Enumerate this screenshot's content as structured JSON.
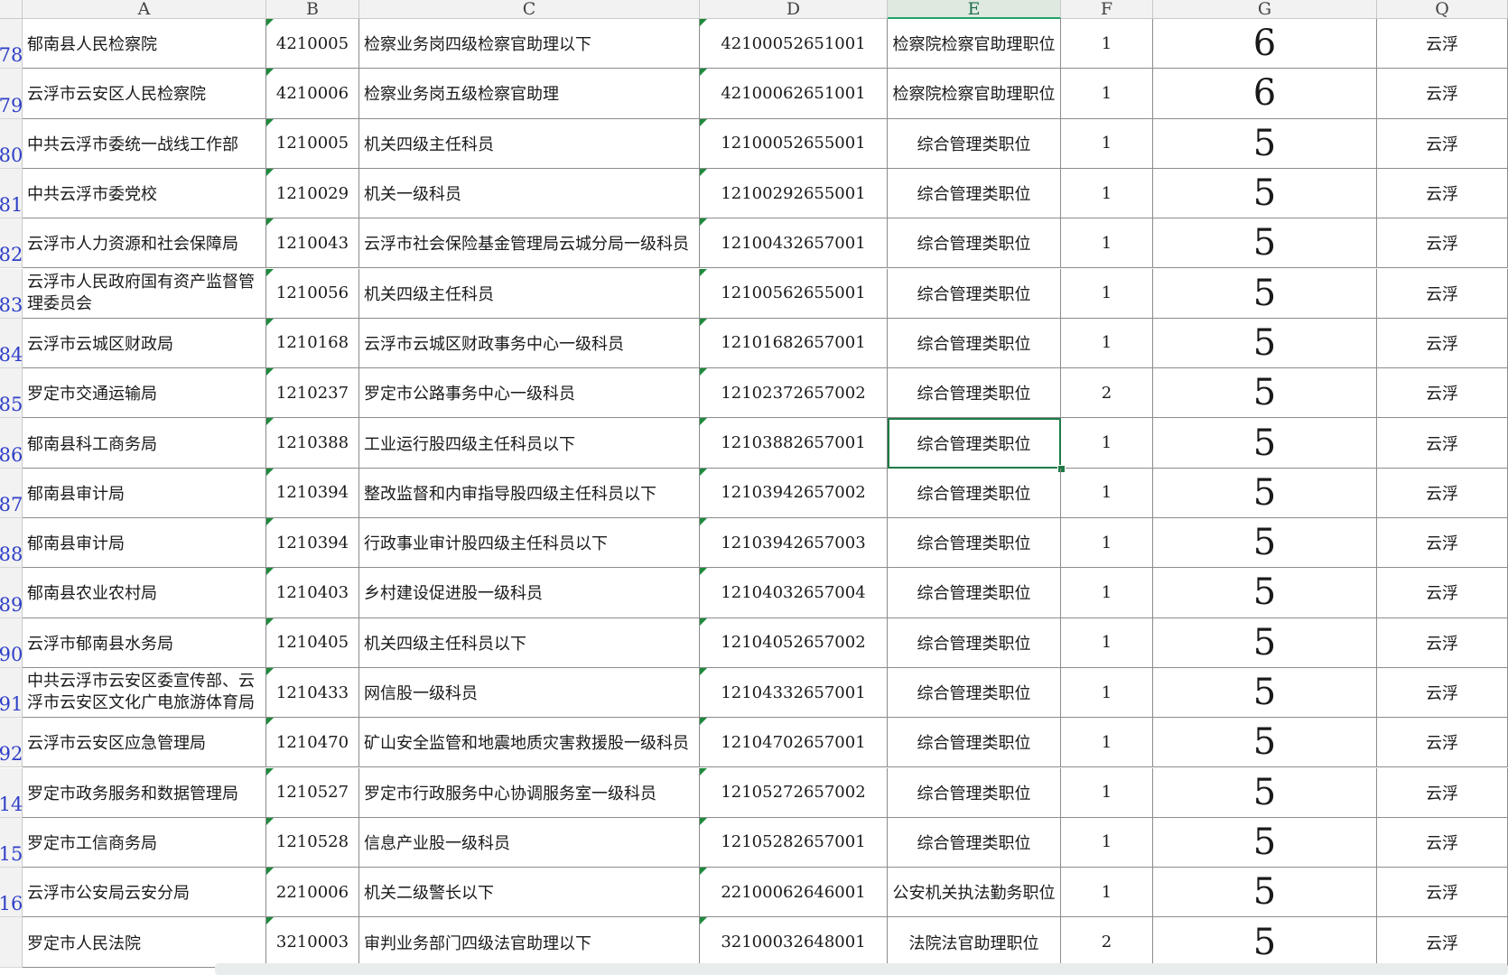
{
  "columns": [
    "A",
    "B",
    "C",
    "D",
    "E",
    "F",
    "G",
    "Q"
  ],
  "selected_column": "E",
  "selected_row": "86",
  "rows": [
    {
      "num": "78",
      "a": "郁南县人民检察院",
      "b": "4210005",
      "c": "检察业务岗四级检察官助理以下",
      "d": "42100052651001",
      "e": "检察院检察官助理职位",
      "f": "1",
      "g": "6",
      "q": "云浮"
    },
    {
      "num": "79",
      "a": "云浮市云安区人民检察院",
      "b": "4210006",
      "c": "检察业务岗五级检察官助理",
      "d": "42100062651001",
      "e": "检察院检察官助理职位",
      "f": "1",
      "g": "6",
      "q": "云浮"
    },
    {
      "num": "80",
      "a": "中共云浮市委统一战线工作部",
      "b": "1210005",
      "c": "机关四级主任科员",
      "d": "12100052655001",
      "e": "综合管理类职位",
      "f": "1",
      "g": "5",
      "q": "云浮"
    },
    {
      "num": "81",
      "a": "中共云浮市委党校",
      "b": "1210029",
      "c": "机关一级科员",
      "d": "12100292655001",
      "e": "综合管理类职位",
      "f": "1",
      "g": "5",
      "q": "云浮"
    },
    {
      "num": "82",
      "a": "云浮市人力资源和社会保障局",
      "b": "1210043",
      "c": "云浮市社会保险基金管理局云城分局一级科员",
      "d": "12100432657001",
      "e": "综合管理类职位",
      "f": "1",
      "g": "5",
      "q": "云浮"
    },
    {
      "num": "83",
      "a": "云浮市人民政府国有资产监督管理委员会",
      "b": "1210056",
      "c": "机关四级主任科员",
      "d": "12100562655001",
      "e": "综合管理类职位",
      "f": "1",
      "g": "5",
      "q": "云浮"
    },
    {
      "num": "84",
      "a": "云浮市云城区财政局",
      "b": "1210168",
      "c": "云浮市云城区财政事务中心一级科员",
      "d": "12101682657001",
      "e": "综合管理类职位",
      "f": "1",
      "g": "5",
      "q": "云浮"
    },
    {
      "num": "85",
      "a": "罗定市交通运输局",
      "b": "1210237",
      "c": "罗定市公路事务中心一级科员",
      "d": "12102372657002",
      "e": "综合管理类职位",
      "f": "2",
      "g": "5",
      "q": "云浮"
    },
    {
      "num": "86",
      "a": "郁南县科工商务局",
      "b": "1210388",
      "c": "工业运行股四级主任科员以下",
      "d": "12103882657001",
      "e": "综合管理类职位",
      "f": "1",
      "g": "5",
      "q": "云浮"
    },
    {
      "num": "87",
      "a": "郁南县审计局",
      "b": "1210394",
      "c": "整改监督和内审指导股四级主任科员以下",
      "d": "12103942657002",
      "e": "综合管理类职位",
      "f": "1",
      "g": "5",
      "q": "云浮"
    },
    {
      "num": "88",
      "a": "郁南县审计局",
      "b": "1210394",
      "c": "行政事业审计股四级主任科员以下",
      "d": "12103942657003",
      "e": "综合管理类职位",
      "f": "1",
      "g": "5",
      "q": "云浮"
    },
    {
      "num": "89",
      "a": "郁南县农业农村局",
      "b": "1210403",
      "c": "乡村建设促进股一级科员",
      "d": "12104032657004",
      "e": "综合管理类职位",
      "f": "1",
      "g": "5",
      "q": "云浮"
    },
    {
      "num": "90",
      "a": "云浮市郁南县水务局",
      "b": "1210405",
      "c": "机关四级主任科员以下",
      "d": "12104052657002",
      "e": "综合管理类职位",
      "f": "1",
      "g": "5",
      "q": "云浮"
    },
    {
      "num": "91",
      "a": "中共云浮市云安区委宣传部、云浮市云安区文化广电旅游体育局",
      "b": "1210433",
      "c": "网信股一级科员",
      "d": "12104332657001",
      "e": "综合管理类职位",
      "f": "1",
      "g": "5",
      "q": "云浮"
    },
    {
      "num": "92",
      "a": "云浮市云安区应急管理局",
      "b": "1210470",
      "c": "矿山安全监管和地震地质灾害救援股一级科员",
      "d": "12104702657001",
      "e": "综合管理类职位",
      "f": "1",
      "g": "5",
      "q": "云浮"
    },
    {
      "num": "14",
      "a": "罗定市政务服务和数据管理局",
      "b": "1210527",
      "c": "罗定市行政服务中心协调服务室一级科员",
      "d": "12105272657002",
      "e": "综合管理类职位",
      "f": "1",
      "g": "5",
      "q": "云浮"
    },
    {
      "num": "15",
      "a": "罗定市工信商务局",
      "b": "1210528",
      "c": "信息产业股一级科员",
      "d": "12105282657001",
      "e": "综合管理类职位",
      "f": "1",
      "g": "5",
      "q": "云浮"
    },
    {
      "num": "16",
      "a": "云浮市公安局云安分局",
      "b": "2210006",
      "c": "机关二级警长以下",
      "d": "22100062646001",
      "e": "公安机关执法勤务职位",
      "f": "1",
      "g": "5",
      "q": "云浮"
    },
    {
      "num": "",
      "a": "罗定市人民法院",
      "b": "3210003",
      "c": "审判业务部门四级法官助理以下",
      "d": "32100032648001",
      "e": "法院法官助理职位",
      "f": "2",
      "g": "5",
      "q": "云浮"
    }
  ]
}
